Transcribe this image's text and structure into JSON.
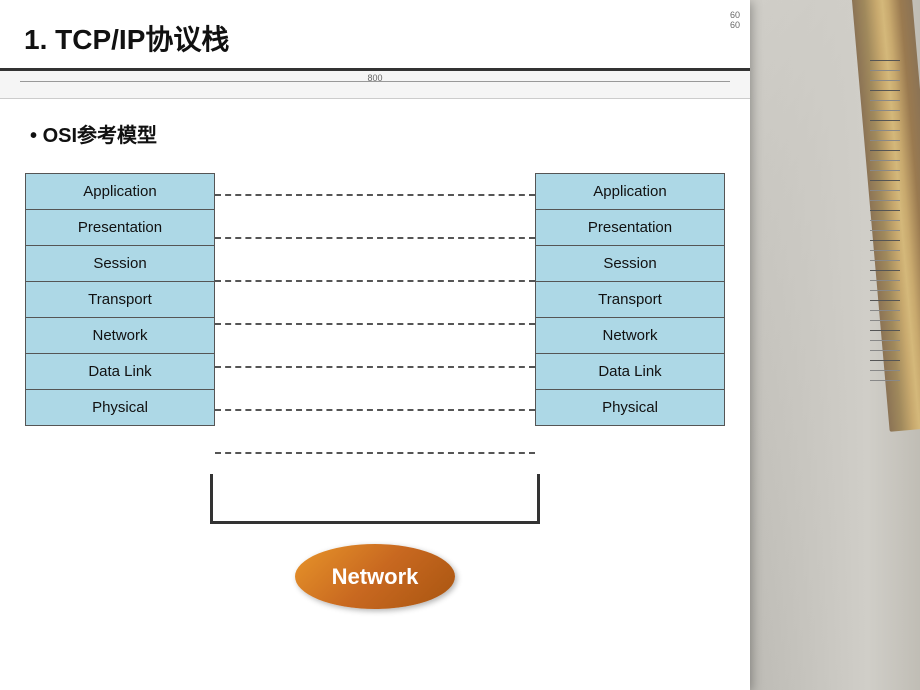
{
  "title": {
    "number": "1.",
    "text": "TCP/IP协议栈"
  },
  "measurements": {
    "line1": "60",
    "line2": "60",
    "ruler_value": "800"
  },
  "bullet": {
    "label": "OSI参考模型"
  },
  "left_stack": {
    "layers": [
      {
        "label": "Application"
      },
      {
        "label": "Presentation"
      },
      {
        "label": "Session"
      },
      {
        "label": "Transport"
      },
      {
        "label": "Network"
      },
      {
        "label": "Data Link"
      },
      {
        "label": "Physical"
      }
    ]
  },
  "right_stack": {
    "layers": [
      {
        "label": "Application"
      },
      {
        "label": "Presentation"
      },
      {
        "label": "Session"
      },
      {
        "label": "Transport"
      },
      {
        "label": "Network"
      },
      {
        "label": "Data Link"
      },
      {
        "label": "Physical"
      }
    ]
  },
  "network_oval": {
    "label": "Network"
  }
}
